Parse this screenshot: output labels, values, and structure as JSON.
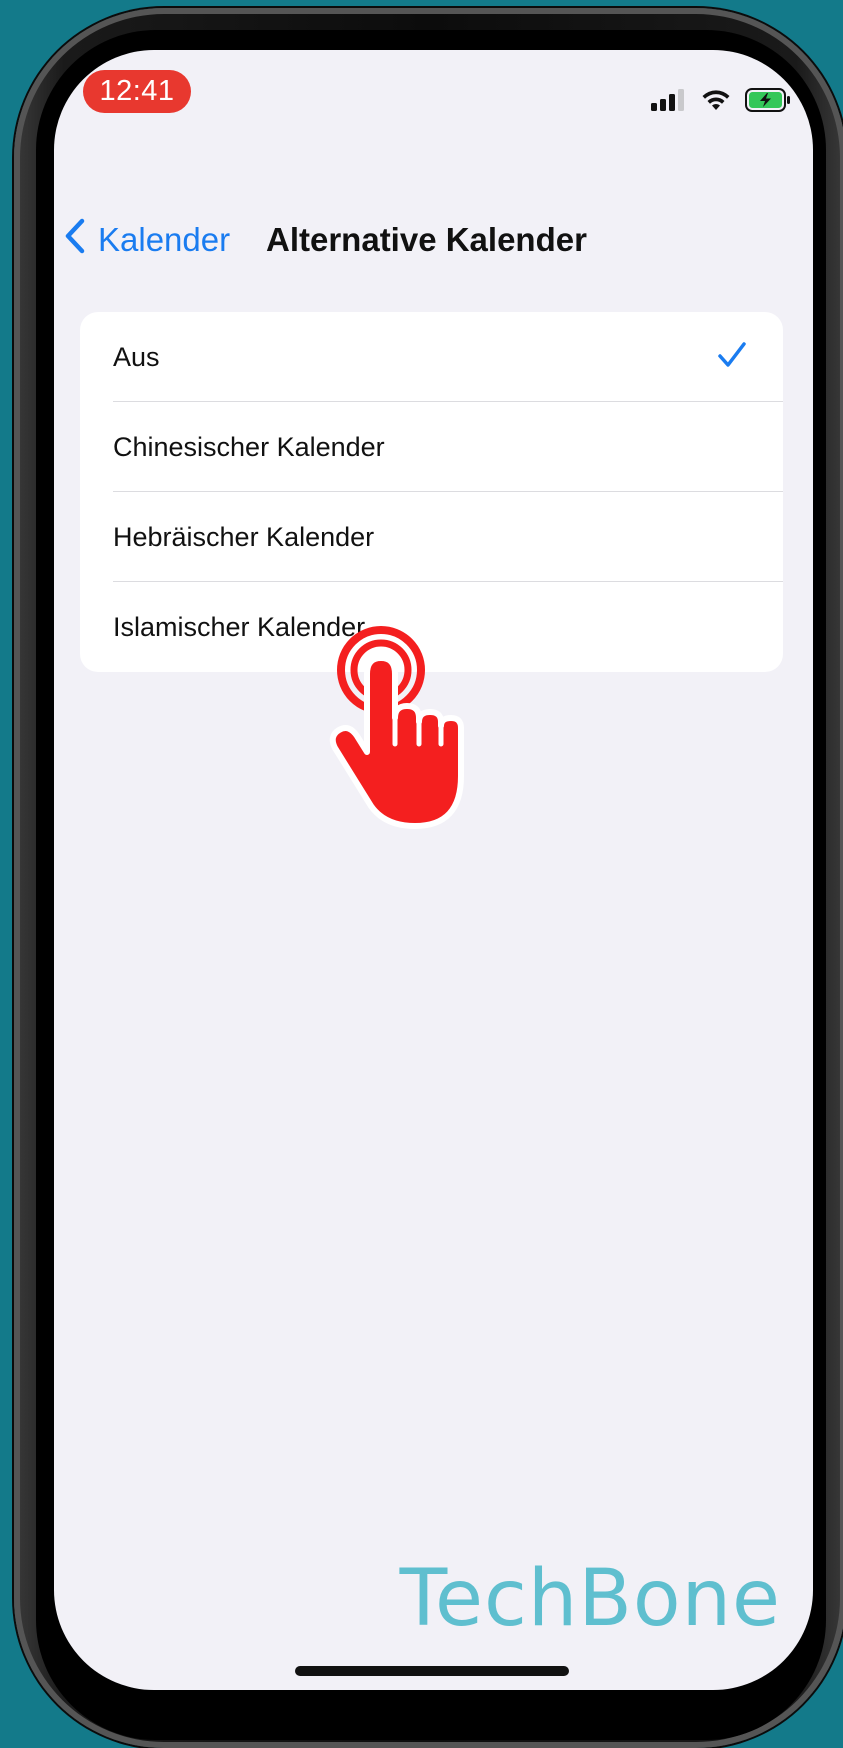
{
  "status_bar": {
    "time": "12:41"
  },
  "nav": {
    "back_label": "Kalender",
    "title": "Alternative Kalender"
  },
  "options": [
    {
      "label": "Aus",
      "selected": true
    },
    {
      "label": "Chinesischer Kalender",
      "selected": false
    },
    {
      "label": "Hebräischer Kalender",
      "selected": false
    },
    {
      "label": "Islamischer Kalender",
      "selected": false
    }
  ],
  "watermark": "TechBone",
  "colors": {
    "accent": "#1a7cf0",
    "time_pill": "#e8382f",
    "background": "#137a8a",
    "screen_bg": "#f2f1f7",
    "hand_pointer": "#f41f1f",
    "battery": "#34c759"
  }
}
